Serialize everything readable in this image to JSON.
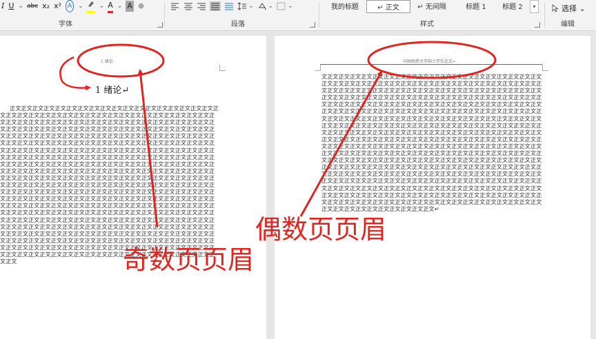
{
  "ribbon": {
    "font_group": {
      "label": "字体",
      "buttons": [
        "I",
        "U",
        "abc",
        "x₂",
        "x²",
        "A",
        "A",
        "A",
        "⊕"
      ]
    },
    "paragraph_group": {
      "label": "段落"
    },
    "styles_group": {
      "label": "样式",
      "items": [
        "我的标题",
        "↵ 正文",
        "↵ 无间隔",
        "标题 1",
        "标题 2"
      ]
    },
    "editing_group": {
      "label": "编辑",
      "select_label": "选择 ⌄"
    }
  },
  "odd_page": {
    "header_text": "1  绪论",
    "chapter_title": "1  绪论↵",
    "body_text": "正文正文正文正文正文正文正文正文正文正文正文正文正文正文正文正文正文正文正文正文正文正文正文正文正文正文正文正文正文正文正文正文正文正文正文正文正文正文正文正文正文正文正文正文正文正文正文正文正文正文正文正文正文正文正文正文正文正文正文正文正文正文正文正文正文正文正文正文正文正文正文正文正文正文正文正文正文正文正文正文正文正文正文正文正文正文正文正文正文正文正文正文正文正文正文正文正文正文正文正文正文正文正文正文正文正文正文正文正文正文正文正文正文正文正文正文正文正文正文正文正文正文正文正文正文正文正文正文正文正文正文正文正文正文正文正文正文正文正文正文正文正文正文正文正文正文正文正文正文正文正文正文正文正文正文正文正文正文正文正文正文正文正文正文正文正文正文正文正文正文正文正文正文正文正文正文正文正文正文正文正文正文正文正文正文正文正文正文正文正文正文正文正文正文正文正文正文正文正文正文正文正文正文正文正文正文正文正文正文正文正文正文正文正文正文正文正文正文正文正文正文正文正文正文正文正文正文正文正文正文正文正文正文正文正文正文正文正文正文正文正文正文正文正文正文正文正文正文正文正文正文正文正文正文正文正文正文正文正文正文正文正文正文正文正文正文正文正文正文正文正文正文正文正文正文正文正文正文正文正文正文正文正文正文正文正文正文正文正文正文正文正文正文正文正文正文正文正文正文正文正文正文正文正文正文正文正文正文正文正文正文正文正文正文正文正文正文正文正文正文正文正文正文正文正文正文正文正文正文正文正文正文正文正文正文正文正文正文正文正文正文正文正文正文正文正文正文正文正文正文正文正文正文正文正文正文正文正文正文正文正文正文正文正文正文正文正文正文正文正文正文正文正文正文正文正文正文正文正文正文正文正文正文正文正文正文正文正文正文正文正文正文正文正文正文正文正文正文正文正文正文正文正文正文正文正文正文正文正文正文正文正文正文正文正文正文正文正文正文"
  },
  "even_page": {
    "header_text": "中国地质大学硕士学位论文↵",
    "body_text": "文正文正文正文正文正文正文正文正文正文正文正文正文正文正文正文正文正文正文正文正文正文正文正文正文正文正文正文正文正文正文正文正文正文正文正文正文正文正文正文正文正文正文正文正文正文正文正文正文正文正文正文正文正文正文正文正文正文正文正文正文正文正文正文正文正文正文正文正文正文正文正文正文正文正文正文正文正文正文正文正文正文正文正文正文正文正文正文正文正文正文正文正文正文正文正文正文正文正文正文正文正文正文正文正文正文正文正文正文正文正文正文正文正文正文正文正文正文正文正文正文正文正文正文正文正文正文正文正文正文正文正文正文正文正文正文正文正文正文正文正文正文正文正文正文正文正文正文正文正文正文正文正文正文正文正文正文正文正文正文正文正文正文正文正文正文正文正文正文正文正文正文正文正文正文正文正文正文正文正文正文正文正文正文正文正文正文正文正文正文正文正文正文正文正文正文正文正文正文正文正文正文正文正文正文正文正文正文正文正文正文正文正文正文正文正文正文正文正文正文正文正文正文正文正文正文正文正文正文正文正文正文正文正文正文正文正文正文正文正文正文正文正文正文正文正文正文正文正文正文正文正文正文正文正文正文正文正文正文正文正文正文正文正文正文正文正文正文正文正文正文正文正文正文正文正文正文正文正文正文正文正文正文正文正文正文正文正文正文正文正文正文正文正文正文正文正文正文正文正文正文正文正文正文正文正文正文正文正文正文正文正文正文正文正文正文正文正文正文正文正文正文正文正文正文正文正文正文正文正文正文正文正文正文正文正文正文正文正文正文正文正文正文正文正文正文正文正文正文正文正文正文正文正文正文正文正文正文正文正文正文正文正文正文正文正文正文正文正文正文正文正文正文正文正文正文正文正文正文正文正文↵"
  },
  "annotations": {
    "odd_label": "奇数页页眉",
    "even_label": "偶数页页眉",
    "color": "#e0241f"
  }
}
